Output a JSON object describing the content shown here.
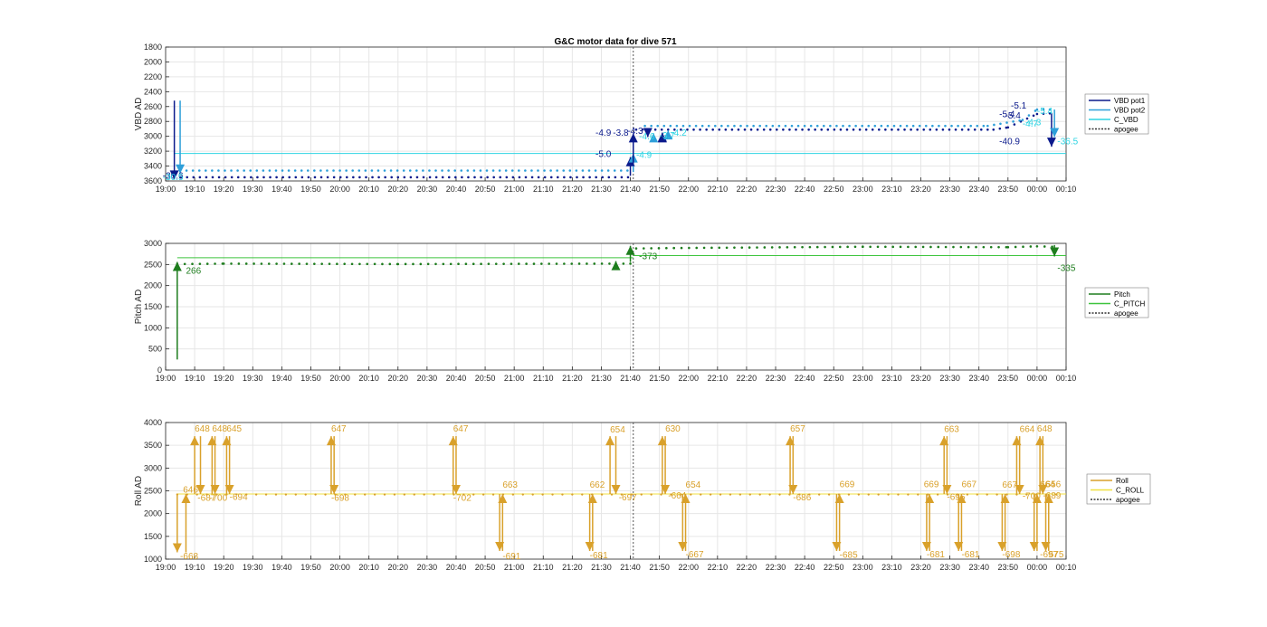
{
  "figure": {
    "title": "G&C motor data for dive 571"
  },
  "colors": {
    "vbd_pot1": "#0b1a8c",
    "vbd_pot2": "#2e9fd9",
    "c_vbd": "#2fd4e3",
    "pitch": "#1e7d1e",
    "c_pitch": "#3dc43d",
    "roll": "#d9a12b",
    "c_roll": "#f0e040",
    "apogee": "#555555",
    "grid": "#e6e6e6",
    "axis": "#262626"
  },
  "chart_data": [
    {
      "id": "vbd",
      "type": "line",
      "ylabel": "VBD AD",
      "ylim": [
        1800,
        3600
      ],
      "y_reversed": true,
      "yticks": [
        1800,
        2000,
        2200,
        2400,
        2600,
        2800,
        3000,
        3200,
        3400,
        3600
      ],
      "xlim": [
        0,
        310
      ],
      "x_ticks": [
        "19:00",
        "19:10",
        "19:20",
        "19:30",
        "19:40",
        "19:50",
        "20:00",
        "20:10",
        "20:20",
        "20:30",
        "20:40",
        "20:50",
        "21:00",
        "21:10",
        "21:20",
        "21:30",
        "21:40",
        "21:50",
        "22:00",
        "22:10",
        "22:20",
        "22:30",
        "22:40",
        "22:50",
        "23:00",
        "23:10",
        "23:20",
        "23:30",
        "23:40",
        "23:50",
        "00:00",
        "00:10"
      ],
      "x_tick_minutes": [
        0,
        10,
        20,
        30,
        40,
        50,
        60,
        70,
        80,
        90,
        100,
        110,
        120,
        130,
        140,
        150,
        160,
        170,
        180,
        190,
        200,
        210,
        220,
        230,
        240,
        250,
        260,
        270,
        280,
        290,
        300,
        310
      ],
      "grid": true,
      "legend": {
        "position": "right",
        "entries": [
          "VBD pot1",
          "VBD pot2",
          "C_VBD",
          "apogee"
        ]
      },
      "apogee_minute": 161,
      "c_vbd_level": 3230,
      "pot1_baseline": [
        [
          3,
          3550
        ],
        [
          160,
          3550
        ]
      ],
      "pot1_plateau": [
        [
          162,
          2910
        ],
        [
          285,
          2910
        ],
        [
          290,
          2880
        ],
        [
          300,
          2700
        ],
        [
          305,
          2690
        ]
      ],
      "pot2_baseline": [
        [
          5,
          3460
        ],
        [
          160,
          3460
        ]
      ],
      "pot2_plateau": [
        [
          165,
          2860
        ],
        [
          283,
          2860
        ],
        [
          295,
          2780
        ],
        [
          300,
          2640
        ],
        [
          306,
          2640
        ]
      ],
      "arrows": [
        {
          "series": "pot1",
          "x": 3,
          "from": 2520,
          "to": 3580
        },
        {
          "series": "pot2",
          "x": 5,
          "from": 2520,
          "to": 3500
        },
        {
          "series": "pot1",
          "x": 160,
          "from": 3530,
          "to": 3280
        },
        {
          "series": "pot2",
          "x": 161,
          "from": 3480,
          "to": 3230
        },
        {
          "series": "pot1",
          "x": 161,
          "from": 3400,
          "to": 2960
        },
        {
          "series": "pot1",
          "x": 166,
          "from": 2940,
          "to": 3010
        },
        {
          "series": "pot1",
          "x": 171,
          "from": 3050,
          "to": 2950
        },
        {
          "series": "pot2",
          "x": 168,
          "from": 3060,
          "to": 2960
        },
        {
          "series": "pot1",
          "x": 171,
          "from": 3030,
          "to": 2960
        },
        {
          "series": "pot2",
          "x": 173,
          "from": 3000,
          "to": 2920
        },
        {
          "series": "pot1",
          "x": 305,
          "from": 2690,
          "to": 3140
        },
        {
          "series": "pot2",
          "x": 306,
          "from": 2640,
          "to": 3010
        }
      ],
      "labels": [
        {
          "x": -1,
          "y": 3570,
          "text": "-30.6",
          "series": "pot1"
        },
        {
          "x": -1,
          "y": 3590,
          "text": "-30.5",
          "series": "pot2"
        },
        {
          "x": 148,
          "y": 2990,
          "text": "-4.9",
          "series": "pot1"
        },
        {
          "x": 154,
          "y": 2990,
          "text": "-3.8",
          "series": "pot1"
        },
        {
          "x": 159,
          "y": 2970,
          "text": "-4.3",
          "series": "pot1"
        },
        {
          "x": 148,
          "y": 3280,
          "text": "-5.0",
          "series": "pot1"
        },
        {
          "x": 162,
          "y": 3290,
          "text": "-4.9",
          "series": "pot2"
        },
        {
          "x": 163,
          "y": 3040,
          "text": "-4.6",
          "series": "pot2"
        },
        {
          "x": 170,
          "y": 3030,
          "text": "-3.7",
          "series": "pot2"
        },
        {
          "x": 174,
          "y": 2990,
          "text": "-4.2",
          "series": "pot2"
        },
        {
          "x": 291,
          "y": 2630,
          "text": "-5.1",
          "series": "pot1"
        },
        {
          "x": 289,
          "y": 2760,
          "text": "-5.4",
          "series": "pot1"
        },
        {
          "x": 287,
          "y": 2740,
          "text": "-5.4",
          "series": "pot1"
        },
        {
          "x": 295,
          "y": 2870,
          "text": "-4.7",
          "series": "pot2"
        },
        {
          "x": 296,
          "y": 2850,
          "text": "-4.3",
          "series": "pot2"
        },
        {
          "x": 300,
          "y": 2700,
          "text": "-5.4",
          "series": "pot2"
        },
        {
          "x": 287,
          "y": 3110,
          "text": "-40.9",
          "series": "pot1"
        },
        {
          "x": 307,
          "y": 3110,
          "text": "-36.5",
          "series": "pot2"
        }
      ]
    },
    {
      "id": "pitch",
      "type": "line",
      "ylabel": "Pitch AD",
      "ylim": [
        0,
        3000
      ],
      "y_reversed": false,
      "yticks": [
        0,
        500,
        1000,
        1500,
        2000,
        2500,
        3000
      ],
      "xlim": [
        0,
        310
      ],
      "x_ticks": [
        "19:00",
        "19:10",
        "19:20",
        "19:30",
        "19:40",
        "19:50",
        "20:00",
        "20:10",
        "20:20",
        "20:30",
        "20:40",
        "20:50",
        "21:00",
        "21:10",
        "21:20",
        "21:30",
        "21:40",
        "21:50",
        "22:00",
        "22:10",
        "22:20",
        "22:30",
        "22:40",
        "22:50",
        "23:00",
        "23:10",
        "23:20",
        "23:30",
        "23:40",
        "23:50",
        "00:00",
        "00:10"
      ],
      "x_tick_minutes": [
        0,
        10,
        20,
        30,
        40,
        50,
        60,
        70,
        80,
        90,
        100,
        110,
        120,
        130,
        140,
        150,
        160,
        170,
        180,
        190,
        200,
        210,
        220,
        230,
        240,
        250,
        260,
        270,
        280,
        290,
        300,
        310
      ],
      "grid": true,
      "legend": {
        "position": "right",
        "entries": [
          "Pitch",
          "C_PITCH",
          "apogee"
        ]
      },
      "apogee_minute": 161,
      "c_pitch_level_before": 2660,
      "c_pitch_level_after": 2710,
      "pitch_trace": [
        [
          4,
          2510
        ],
        [
          20,
          2520
        ],
        [
          80,
          2510
        ],
        [
          155,
          2520
        ],
        [
          160,
          2520
        ],
        [
          162,
          2880
        ],
        [
          175,
          2890
        ],
        [
          240,
          2920
        ],
        [
          290,
          2910
        ],
        [
          300,
          2930
        ],
        [
          306,
          2920
        ]
      ],
      "arrows": [
        {
          "x": 4,
          "from": 250,
          "to": 2560
        },
        {
          "x": 155,
          "from": 2510,
          "to": 2580
        },
        {
          "x": 160,
          "from": 2560,
          "to": 2940
        },
        {
          "x": 306,
          "from": 2960,
          "to": 2690
        }
      ],
      "labels": [
        {
          "x": 7,
          "y": 2280,
          "text": "266"
        },
        {
          "x": 163,
          "y": 2630,
          "text": "-373"
        },
        {
          "x": 307,
          "y": 2350,
          "text": "-335"
        }
      ]
    },
    {
      "id": "roll",
      "type": "line",
      "ylabel": "Roll AD",
      "ylim": [
        1000,
        4000
      ],
      "y_reversed": false,
      "yticks": [
        1000,
        1500,
        2000,
        2500,
        3000,
        3500,
        4000
      ],
      "xlim": [
        0,
        310
      ],
      "x_ticks": [
        "19:00",
        "19:10",
        "19:20",
        "19:30",
        "19:40",
        "19:50",
        "20:00",
        "20:10",
        "20:20",
        "20:30",
        "20:40",
        "20:50",
        "21:00",
        "21:10",
        "21:20",
        "21:30",
        "21:40",
        "21:50",
        "22:00",
        "22:10",
        "22:20",
        "22:30",
        "22:40",
        "22:50",
        "23:00",
        "23:10",
        "23:20",
        "23:30",
        "23:40",
        "23:50",
        "00:00",
        "00:10"
      ],
      "x_tick_minutes": [
        0,
        10,
        20,
        30,
        40,
        50,
        60,
        70,
        80,
        90,
        100,
        110,
        120,
        130,
        140,
        150,
        160,
        170,
        180,
        190,
        200,
        210,
        220,
        230,
        240,
        250,
        260,
        270,
        280,
        290,
        300,
        310
      ],
      "grid": true,
      "legend": {
        "position": "right",
        "entries": [
          "Roll",
          "C_ROLL",
          "apogee"
        ]
      },
      "apogee_minute": 161,
      "c_roll_level": 2430,
      "roll_level": 2420,
      "pulses": [
        {
          "x": 4,
          "from": 2430,
          "to": 1150
        },
        {
          "x": 7,
          "from": 1150,
          "to": 2430
        },
        {
          "x": 10,
          "from": 2430,
          "to": 3700
        },
        {
          "x": 12,
          "from": 3700,
          "to": 2430
        },
        {
          "x": 16,
          "from": 2430,
          "to": 3700
        },
        {
          "x": 17,
          "from": 3700,
          "to": 2430
        },
        {
          "x": 21,
          "from": 2430,
          "to": 3700
        },
        {
          "x": 22,
          "from": 3700,
          "to": 2430
        },
        {
          "x": 57,
          "from": 2430,
          "to": 3700
        },
        {
          "x": 58,
          "from": 3700,
          "to": 2430
        },
        {
          "x": 99,
          "from": 2430,
          "to": 3700
        },
        {
          "x": 100,
          "from": 3700,
          "to": 2430
        },
        {
          "x": 115,
          "from": 2430,
          "to": 1180
        },
        {
          "x": 116,
          "from": 1180,
          "to": 2430
        },
        {
          "x": 146,
          "from": 2430,
          "to": 1180
        },
        {
          "x": 147,
          "from": 1180,
          "to": 2430
        },
        {
          "x": 153,
          "from": 2430,
          "to": 3700
        },
        {
          "x": 155,
          "from": 3700,
          "to": 2430
        },
        {
          "x": 171,
          "from": 2430,
          "to": 3700
        },
        {
          "x": 172,
          "from": 3700,
          "to": 2430
        },
        {
          "x": 178,
          "from": 2430,
          "to": 1180
        },
        {
          "x": 179,
          "from": 1180,
          "to": 2430
        },
        {
          "x": 215,
          "from": 2430,
          "to": 3700
        },
        {
          "x": 216,
          "from": 3700,
          "to": 2430
        },
        {
          "x": 231,
          "from": 2430,
          "to": 1180
        },
        {
          "x": 232,
          "from": 1180,
          "to": 2430
        },
        {
          "x": 262,
          "from": 2430,
          "to": 1180
        },
        {
          "x": 263,
          "from": 1180,
          "to": 2430
        },
        {
          "x": 268,
          "from": 2430,
          "to": 3700
        },
        {
          "x": 269,
          "from": 3700,
          "to": 2430
        },
        {
          "x": 273,
          "from": 2430,
          "to": 1180
        },
        {
          "x": 274,
          "from": 1180,
          "to": 2430
        },
        {
          "x": 288,
          "from": 2430,
          "to": 1180
        },
        {
          "x": 289,
          "from": 1180,
          "to": 2430
        },
        {
          "x": 293,
          "from": 2430,
          "to": 3700
        },
        {
          "x": 294,
          "from": 3700,
          "to": 2430
        },
        {
          "x": 299,
          "from": 2430,
          "to": 1180
        },
        {
          "x": 300,
          "from": 1180,
          "to": 2430
        },
        {
          "x": 301,
          "from": 2430,
          "to": 3700
        },
        {
          "x": 302,
          "from": 3700,
          "to": 2430
        },
        {
          "x": 303,
          "from": 2430,
          "to": 1180
        },
        {
          "x": 304,
          "from": 1180,
          "to": 2430
        }
      ],
      "labels": [
        {
          "x": 5,
          "y": 1000,
          "text": "-668"
        },
        {
          "x": 6,
          "y": 2460,
          "text": "646"
        },
        {
          "x": 10,
          "y": 3800,
          "text": "648"
        },
        {
          "x": 11,
          "y": 2280,
          "text": "-687"
        },
        {
          "x": 15,
          "y": 2280,
          "text": "-700"
        },
        {
          "x": 16,
          "y": 3800,
          "text": "648"
        },
        {
          "x": 21,
          "y": 3800,
          "text": "645"
        },
        {
          "x": 22,
          "y": 2300,
          "text": "-694"
        },
        {
          "x": 57,
          "y": 3800,
          "text": "647"
        },
        {
          "x": 57,
          "y": 2280,
          "text": "-698"
        },
        {
          "x": 99,
          "y": 3800,
          "text": "647"
        },
        {
          "x": 99,
          "y": 2280,
          "text": "-702"
        },
        {
          "x": 116,
          "y": 2570,
          "text": "663"
        },
        {
          "x": 116,
          "y": 1000,
          "text": "-691"
        },
        {
          "x": 146,
          "y": 2570,
          "text": "662"
        },
        {
          "x": 146,
          "y": 1020,
          "text": "-681"
        },
        {
          "x": 153,
          "y": 3780,
          "text": "654"
        },
        {
          "x": 156,
          "y": 2290,
          "text": "-697"
        },
        {
          "x": 172,
          "y": 3800,
          "text": "630"
        },
        {
          "x": 173,
          "y": 2330,
          "text": "-664"
        },
        {
          "x": 179,
          "y": 2570,
          "text": "654"
        },
        {
          "x": 179,
          "y": 1040,
          "text": "-667"
        },
        {
          "x": 215,
          "y": 3800,
          "text": "657"
        },
        {
          "x": 216,
          "y": 2290,
          "text": "-686"
        },
        {
          "x": 232,
          "y": 2580,
          "text": "669"
        },
        {
          "x": 232,
          "y": 1030,
          "text": "-685"
        },
        {
          "x": 261,
          "y": 2580,
          "text": "669"
        },
        {
          "x": 262,
          "y": 1040,
          "text": "-681"
        },
        {
          "x": 268,
          "y": 3790,
          "text": "663"
        },
        {
          "x": 269,
          "y": 2300,
          "text": "-696"
        },
        {
          "x": 274,
          "y": 2580,
          "text": "667"
        },
        {
          "x": 274,
          "y": 1040,
          "text": "-681"
        },
        {
          "x": 288,
          "y": 2570,
          "text": "667"
        },
        {
          "x": 288,
          "y": 1040,
          "text": "-698"
        },
        {
          "x": 294,
          "y": 3790,
          "text": "664"
        },
        {
          "x": 295,
          "y": 2320,
          "text": "-700"
        },
        {
          "x": 300,
          "y": 3800,
          "text": "648"
        },
        {
          "x": 301,
          "y": 2580,
          "text": "664"
        },
        {
          "x": 302,
          "y": 2330,
          "text": "-689"
        },
        {
          "x": 303,
          "y": 2580,
          "text": "656"
        },
        {
          "x": 301,
          "y": 1040,
          "text": "-697"
        },
        {
          "x": 304,
          "y": 1040,
          "text": "575"
        }
      ]
    }
  ]
}
